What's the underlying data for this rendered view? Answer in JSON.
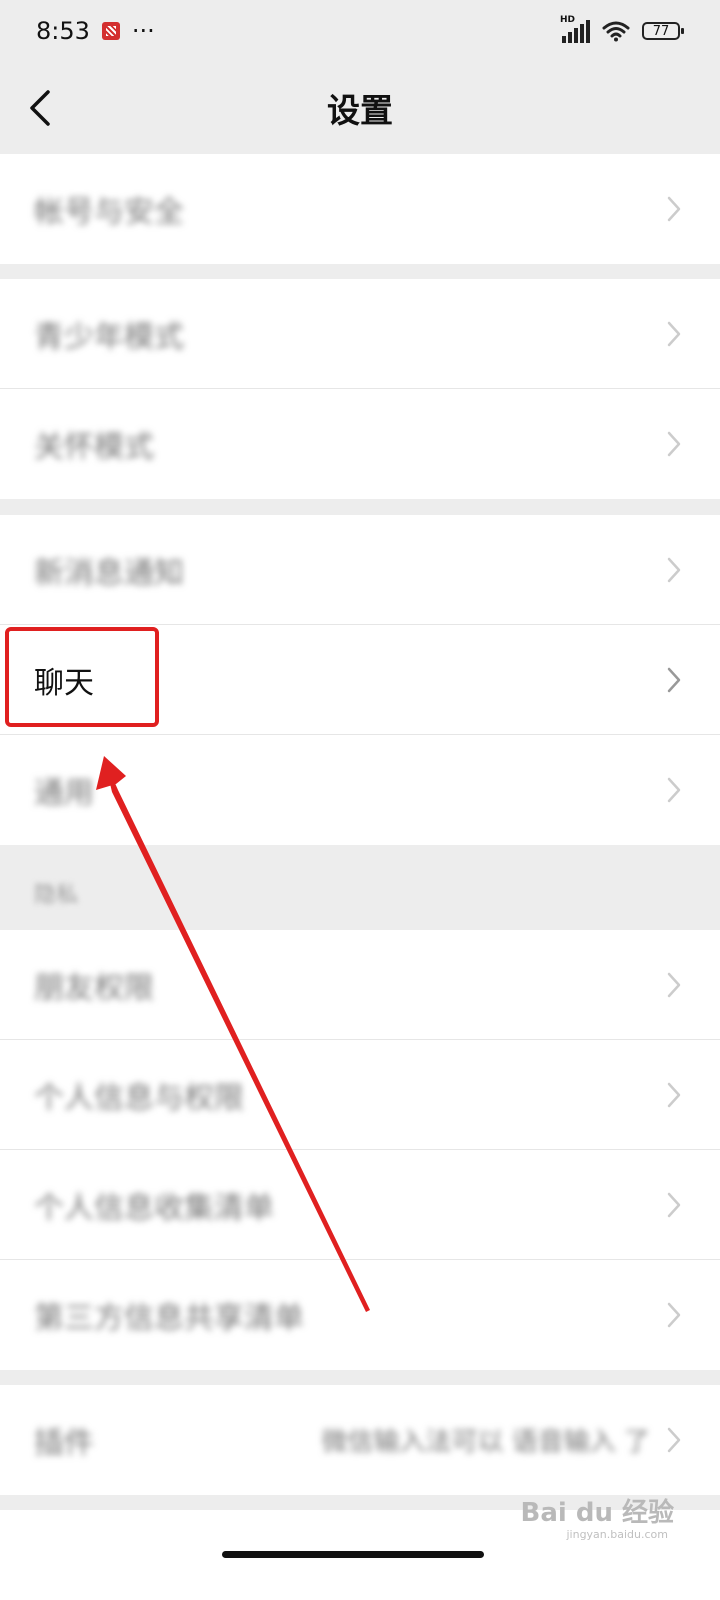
{
  "status_bar": {
    "time": "8:53",
    "more": "···",
    "network": "HD",
    "battery": "77",
    "icons": [
      "app-notification-icon",
      "signal-icon",
      "wifi-icon",
      "battery-icon"
    ]
  },
  "nav": {
    "title": "设置",
    "back_icon": "chevron-left-icon"
  },
  "groups": [
    {
      "items": [
        {
          "label": "帐号与安全",
          "blurred": true
        }
      ]
    },
    {
      "items": [
        {
          "label": "青少年模式",
          "blurred": true
        },
        {
          "label": "关怀模式",
          "blurred": true
        }
      ]
    },
    {
      "items": [
        {
          "label": "新消息通知",
          "blurred": true
        },
        {
          "label": "聊天",
          "blurred": false
        },
        {
          "label": "通用",
          "blurred": true
        }
      ]
    }
  ],
  "privacy_section": {
    "header": "隐私",
    "items": [
      {
        "label": "朋友权限",
        "blurred": true
      },
      {
        "label": "个人信息与权限",
        "blurred": true
      },
      {
        "label": "个人信息收集清单",
        "blurred": true
      },
      {
        "label": "第三方信息共享清单",
        "blurred": true
      }
    ]
  },
  "plugins_row": {
    "label": "插件",
    "value": "微信输入法可以 语音输入 了",
    "blurred": true
  },
  "annotation": {
    "color": "#e02020",
    "target": "聊天"
  },
  "watermark": {
    "brand": "Bai du 经验",
    "sub": "jingyan.baidu.com"
  }
}
